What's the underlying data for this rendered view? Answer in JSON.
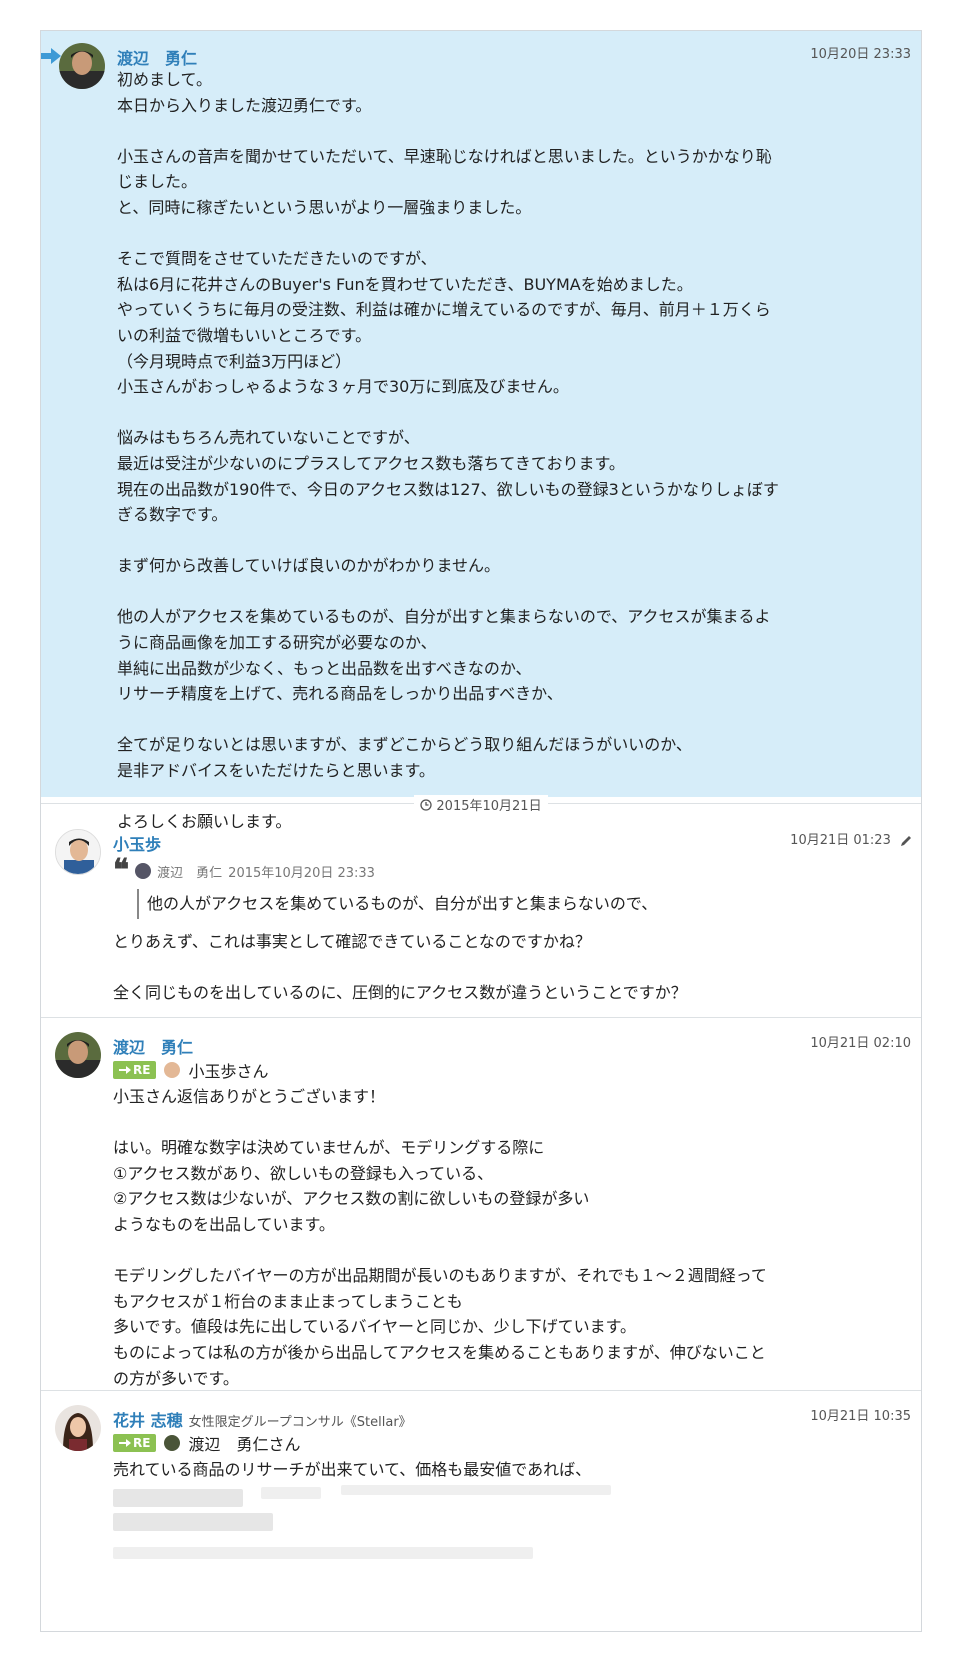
{
  "messages": [
    {
      "sender": "渡辺　勇仁",
      "time": "10月20日 23:33",
      "body": "初めまして。\n本日から入りました渡辺勇仁です。\n\n小玉さんの音声を聞かせていただいて、早速恥じなければと思いました。というかかなり恥\nじました。\nと、同時に稼ぎたいという思いがより一層強まりました。\n\nそこで質問をさせていただきたいのですが、\n私は6月に花井さんのBuyer's Funを買わせていただき、BUYMAを始めました。\nやっていくうちに毎月の受注数、利益は確かに増えているのですが、毎月、前月＋１万くら\nいの利益で微増もいいところです。\n（今月現時点で利益3万円ほど）\n小玉さんがおっしゃるような３ヶ月で30万に到底及びません。\n\n悩みはもちろん売れていないことですが、\n最近は受注が少ないのにプラスしてアクセス数も落ちてきております。\n現在の出品数が190件で、今日のアクセス数は127、欲しいもの登録3というかなりしょぼす\nぎる数字です。\n\nまず何から改善していけば良いのかがわかりません。\n\n他の人がアクセスを集めているものが、自分が出すと集まらないので、アクセスが集まるよ\nうに商品画像を加工する研究が必要なのか、\n単純に出品数が少なく、もっと出品数を出すべきなのか、\nリサーチ精度を上げて、売れる商品をしっかり出品すべきか、\n\n全てが足りないとは思いますが、まずどこからどう取り組んだほうがいいのか、\n是非アドバイスをいただけたらと思います。\n\nよろしくお願いします。"
    },
    {
      "sender": "小玉歩",
      "time": "10月21日 01:23",
      "quote_author": "渡辺　勇仁",
      "quote_time": "2015年10月20日 23:33",
      "quote_text": "他の人がアクセスを集めているものが、自分が出すと集まらないので、",
      "body": "とりあえず、これは事実として確認できていることなのですかね？\n\n全く同じものを出しているのに、圧倒的にアクセス数が違うということですか？"
    },
    {
      "sender": "渡辺　勇仁",
      "time": "10月21日 02:10",
      "re_label": "RE",
      "reply_to": "小玉歩さん",
      "body": "小玉さん返信ありがとうございます！\n\nはい。明確な数字は決めていませんが、モデリングする際に\n①アクセス数があり、欲しいもの登録も入っている、\n②アクセス数は少ないが、アクセス数の割に欲しいもの登録が多い\nようなものを出品しています。\n\nモデリングしたバイヤーの方が出品期間が長いのもありますが、それでも１～２週間経って\nもアクセスが１桁台のまま止まってしまうことも\n多いです。値段は先に出しているバイヤーと同じか、少し下げています。\nものによっては私の方が後から出品してアクセスを集めることもありますが、伸びないこと\nの方が多いです。"
    },
    {
      "sender": "花井 志穂",
      "sender_org": "女性限定グループコンサル《Stellar》",
      "time": "10月21日 10:35",
      "re_label": "RE",
      "reply_to": "渡辺　勇仁さん",
      "body": "売れている商品のリサーチが出来ていて、価格も最安値であれば、"
    }
  ],
  "date_separator": "2015年10月21日",
  "icons": [
    "arrow-right-icon",
    "clock-icon",
    "quote-icon",
    "pencil-icon",
    "reply-arrow-icon"
  ],
  "colors": {
    "highlight_bg": "#d6edf9",
    "sender_name": "#2f7fb9",
    "re_badge": "#8cc152",
    "arrow": "#3d9ad6"
  }
}
